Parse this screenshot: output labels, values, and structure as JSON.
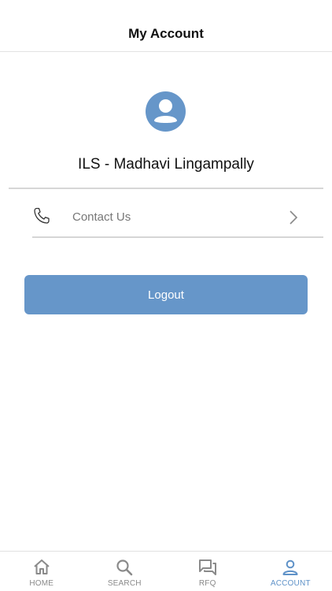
{
  "header": {
    "title": "My Account"
  },
  "profile": {
    "name": "ILS - Madhavi Lingampally",
    "avatar_icon": "user-circle-icon"
  },
  "menu": {
    "contact": {
      "label": "Contact Us",
      "icon": "phone-icon",
      "chevron_icon": "chevron-right-icon"
    }
  },
  "actions": {
    "logout_label": "Logout"
  },
  "tabs": [
    {
      "label": "HOME",
      "icon": "home-icon",
      "active": false
    },
    {
      "label": "SEARCH",
      "icon": "search-icon",
      "active": false
    },
    {
      "label": "RFQ",
      "icon": "chat-icon",
      "active": false
    },
    {
      "label": "ACCOUNT",
      "icon": "user-icon",
      "active": true
    }
  ],
  "colors": {
    "accent": "#6696c9",
    "active_tab": "#5f92c8",
    "inactive_tab": "#8a8a8a"
  }
}
